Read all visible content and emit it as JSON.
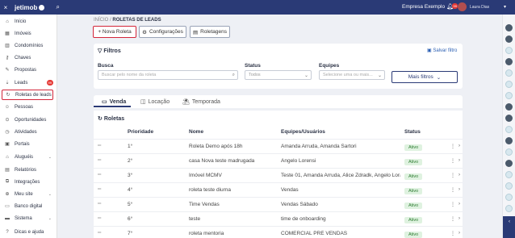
{
  "topbar": {
    "close_icon": "×",
    "logo_text": "jetimob",
    "company": "Empresa Exemplo",
    "notif_count": "99",
    "user_name": "Laura Dias"
  },
  "sidebar": {
    "items": [
      {
        "label": "Início",
        "icon": "⌂"
      },
      {
        "label": "Imóveis",
        "icon": "▦"
      },
      {
        "label": "Condomínios",
        "icon": "▥"
      },
      {
        "label": "Chaves",
        "icon": "⚷"
      },
      {
        "label": "Propostas",
        "icon": "✎"
      },
      {
        "label": "Leads",
        "icon": "⇣",
        "badge": "99"
      },
      {
        "label": "Roletas de leads",
        "icon": "↻"
      },
      {
        "label": "Pessoas",
        "icon": "☺"
      },
      {
        "label": "Oportunidades",
        "icon": "⊙"
      },
      {
        "label": "Atividades",
        "icon": "◷"
      },
      {
        "label": "Portais",
        "icon": "▣"
      },
      {
        "label": "Aluguéis",
        "icon": "⌂"
      },
      {
        "label": "Relatórios",
        "icon": "▤"
      },
      {
        "label": "Integrações",
        "icon": "⧉"
      },
      {
        "label": "Meu site",
        "icon": "⊕"
      },
      {
        "label": "Banco digital",
        "icon": "▭"
      },
      {
        "label": "Sistema",
        "icon": "▬"
      },
      {
        "label": "Dicas e ajuda",
        "icon": "?"
      }
    ]
  },
  "breadcrumb": {
    "home": "INÍCIO",
    "sep": " / ",
    "current": "ROLETAS DE LEADS"
  },
  "actions": {
    "new": "+ Nova Roleta",
    "config": "Configurações",
    "roletagens": "Roletagens"
  },
  "filtros": {
    "title": "Filtros",
    "save": "Salvar filtro",
    "busca_label": "Busca",
    "busca_placeholder": "Buscar pelo nome da roleta",
    "status_label": "Status",
    "status_value": "Todos",
    "equipes_label": "Equipes",
    "equipes_placeholder": "Selecione uma ou mais...",
    "mais": "Mais filtros"
  },
  "tabs": [
    {
      "label": "Venda",
      "icon": "▭"
    },
    {
      "label": "Locação",
      "icon": "◫"
    },
    {
      "label": "Temporada",
      "icon": "⛱"
    }
  ],
  "table": {
    "title": "Roletas",
    "headers": {
      "prioridade": "Prioridade",
      "nome": "Nome",
      "equipes": "Equipes/Usuários",
      "status": "Status"
    },
    "rows": [
      {
        "prioridade": "1°",
        "nome": "Roleta Demo após 18h",
        "equipes": "Amanda Arruda, Amanda Sartori",
        "status": "Ativo"
      },
      {
        "prioridade": "2°",
        "nome": "casa Nova teste madrugada",
        "equipes": "Angelo Lorensi",
        "status": "Ativo"
      },
      {
        "prioridade": "3°",
        "nome": "Imóvel MCMV",
        "equipes": "Teste 01, Amanda Arruda, Alice Zdradk, Angelo Lora...",
        "status": "Ativo"
      },
      {
        "prioridade": "4°",
        "nome": "roleta teste diurna",
        "equipes": "Vendas",
        "status": "Ativo"
      },
      {
        "prioridade": "5°",
        "nome": "Time Vendas",
        "equipes": "Vendas Sábado",
        "status": "Ativo"
      },
      {
        "prioridade": "6°",
        "nome": "teste",
        "equipes": "time de onboarding",
        "status": "Ativo"
      },
      {
        "prioridade": "7°",
        "nome": "roleta mentoria",
        "equipes": "COMERCIAL PRÉ VENDAS",
        "status": "Ativo"
      }
    ]
  },
  "colors": {
    "brand": "#2a3a76",
    "highlight": "#d3263a",
    "active_status": "#2e7d32"
  }
}
